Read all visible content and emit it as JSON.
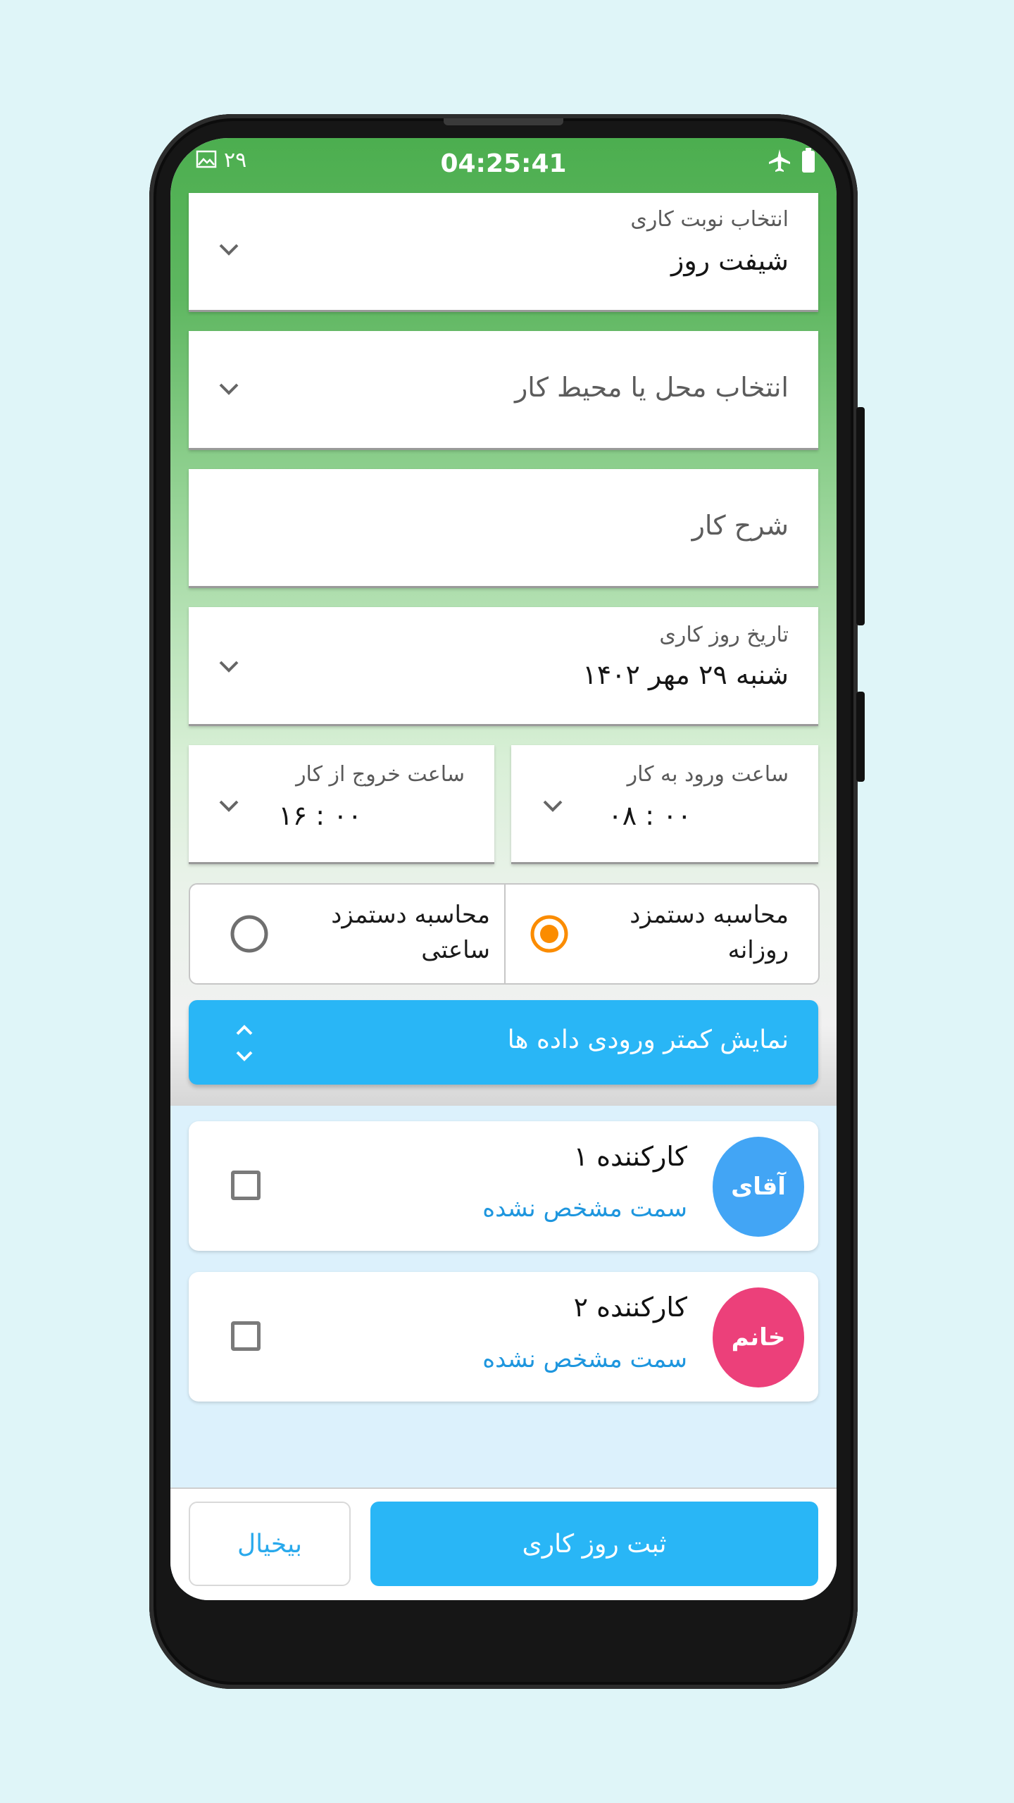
{
  "status_bar": {
    "left_number": "۲۹",
    "time": "04:25:41",
    "left_icon": "image-icon",
    "right_icons": [
      "airplane-icon",
      "battery-icon"
    ]
  },
  "shift": {
    "label": "انتخاب نوبت کاری",
    "value": "شیفت روز"
  },
  "workplace": {
    "placeholder": "انتخاب محل یا محیط کار"
  },
  "description": {
    "placeholder": "شرح کار"
  },
  "work_date": {
    "label": "تاریخ روز کاری",
    "value": "شنبه ۲۹ مهر ۱۴۰۲"
  },
  "time_in": {
    "label": "ساعت ورود به کار",
    "value": "۰۸ : ۰۰"
  },
  "time_out": {
    "label": "ساعت خروج از کار",
    "value": "۱۶ : ۰۰"
  },
  "wage_mode": {
    "daily_line1": "محاسبه دستمزد",
    "daily_line2": "روزانه",
    "hourly_line1": "محاسبه دستمزد",
    "hourly_line2": "ساعتی",
    "selected": "daily"
  },
  "toggle_inputs": {
    "label": "نمایش کمتر ورودی داده ها"
  },
  "employees": [
    {
      "avatar_text": "آقای",
      "avatar_color": "#42a5f5",
      "name": "کارکننده ۱",
      "role": "سمت مشخص نشده"
    },
    {
      "avatar_text": "خانم",
      "avatar_color": "#ec407a",
      "name": "کارکننده ۲",
      "role": "سمت مشخص نشده"
    }
  ],
  "actions": {
    "submit_label": "ثبت روز کاری",
    "cancel_label": "بیخیال"
  },
  "colors": {
    "header_green": "#4cae4f",
    "accent_blue": "#29b6f6",
    "radio_orange": "#fb8c00"
  }
}
